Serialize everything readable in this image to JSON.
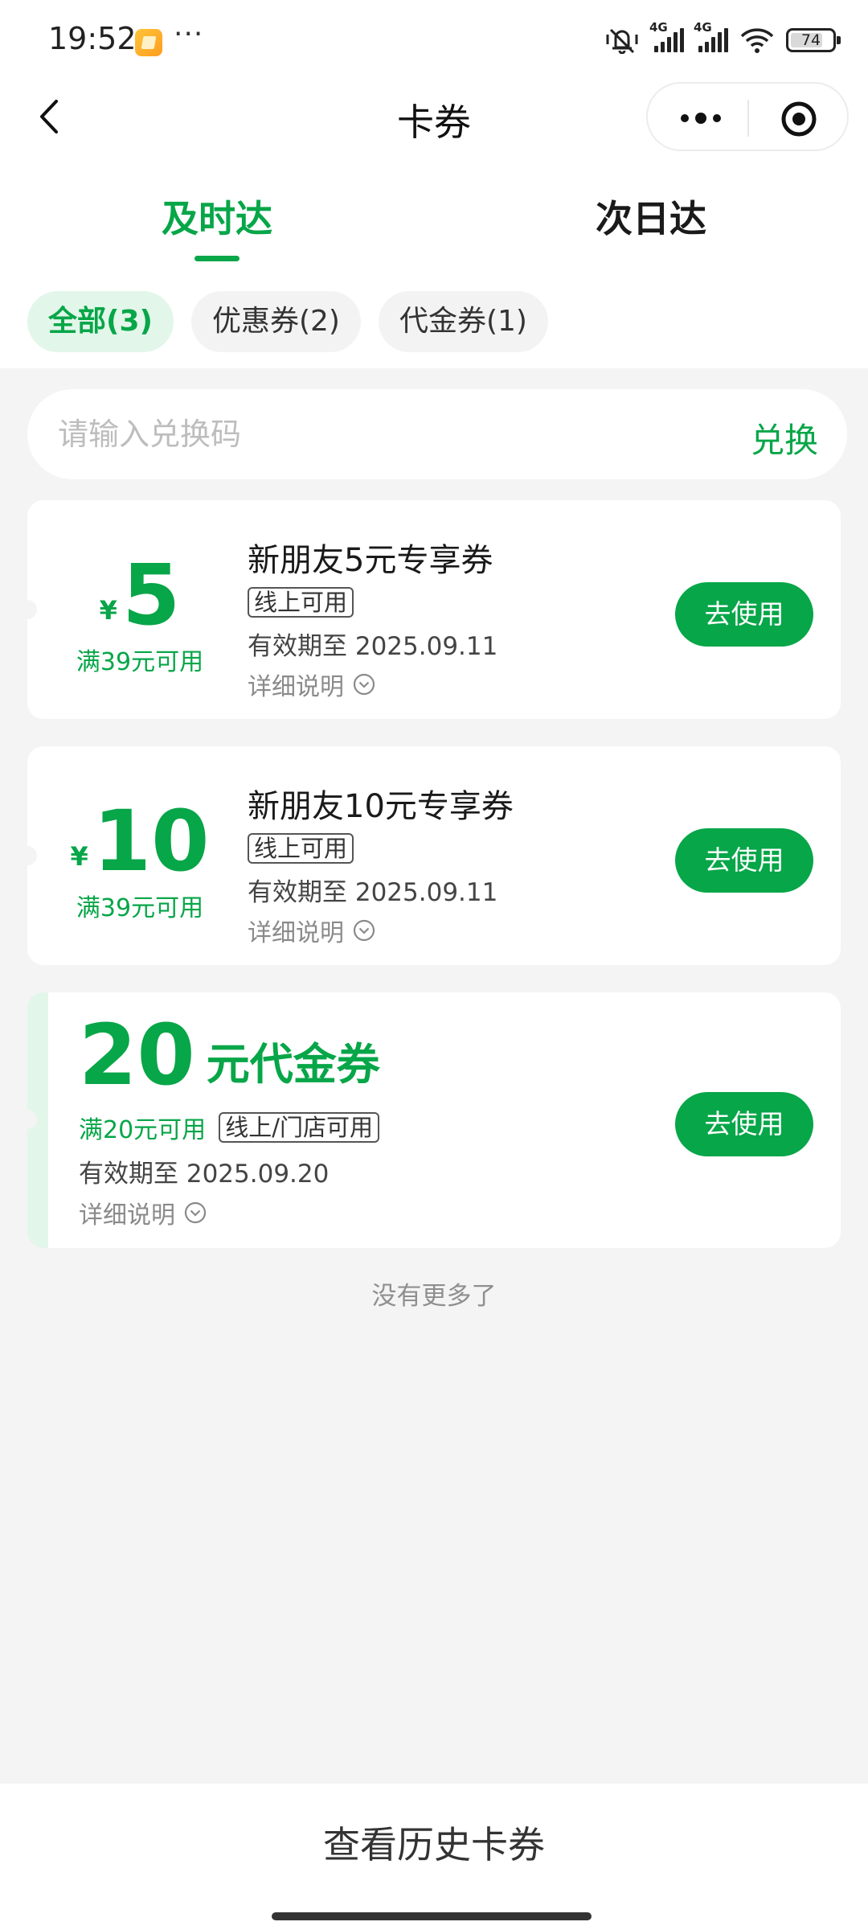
{
  "status_bar": {
    "time": "19:52",
    "dots": "···",
    "network_1": "4G",
    "network_2": "4G",
    "battery": "74"
  },
  "nav": {
    "title": "卡券"
  },
  "tabs": [
    {
      "label": "及时达",
      "active": true
    },
    {
      "label": "次日达",
      "active": false
    }
  ],
  "filters": [
    {
      "label": "全部(3)",
      "active": true
    },
    {
      "label": "优惠券(2)",
      "active": false
    },
    {
      "label": "代金券(1)",
      "active": false
    }
  ],
  "redeem": {
    "placeholder": "请输入兑换码",
    "button": "兑换"
  },
  "coupons": [
    {
      "currency": "¥",
      "amount": "5",
      "condition": "满39元可用",
      "name": "新朋友5元专享券",
      "tag": "线上可用",
      "expiry": "有效期至 2025.09.11",
      "detail": "详细说明",
      "button": "去使用"
    },
    {
      "currency": "¥",
      "amount": "10",
      "condition": "满39元可用",
      "name": "新朋友10元专享券",
      "tag": "线上可用",
      "expiry": "有效期至 2025.09.11",
      "detail": "详细说明",
      "button": "去使用"
    }
  ],
  "voucher": {
    "amount": "20",
    "unit": "元代金券",
    "condition": "满20元可用",
    "tag": "线上/门店可用",
    "expiry": "有效期至 2025.09.20",
    "detail": "详细说明",
    "button": "去使用"
  },
  "no_more": "没有更多了",
  "bottom": {
    "history": "查看历史卡券"
  },
  "colors": {
    "accent": "#07a648",
    "accent_light": "#e3f6ea",
    "background": "#f4f4f4"
  }
}
